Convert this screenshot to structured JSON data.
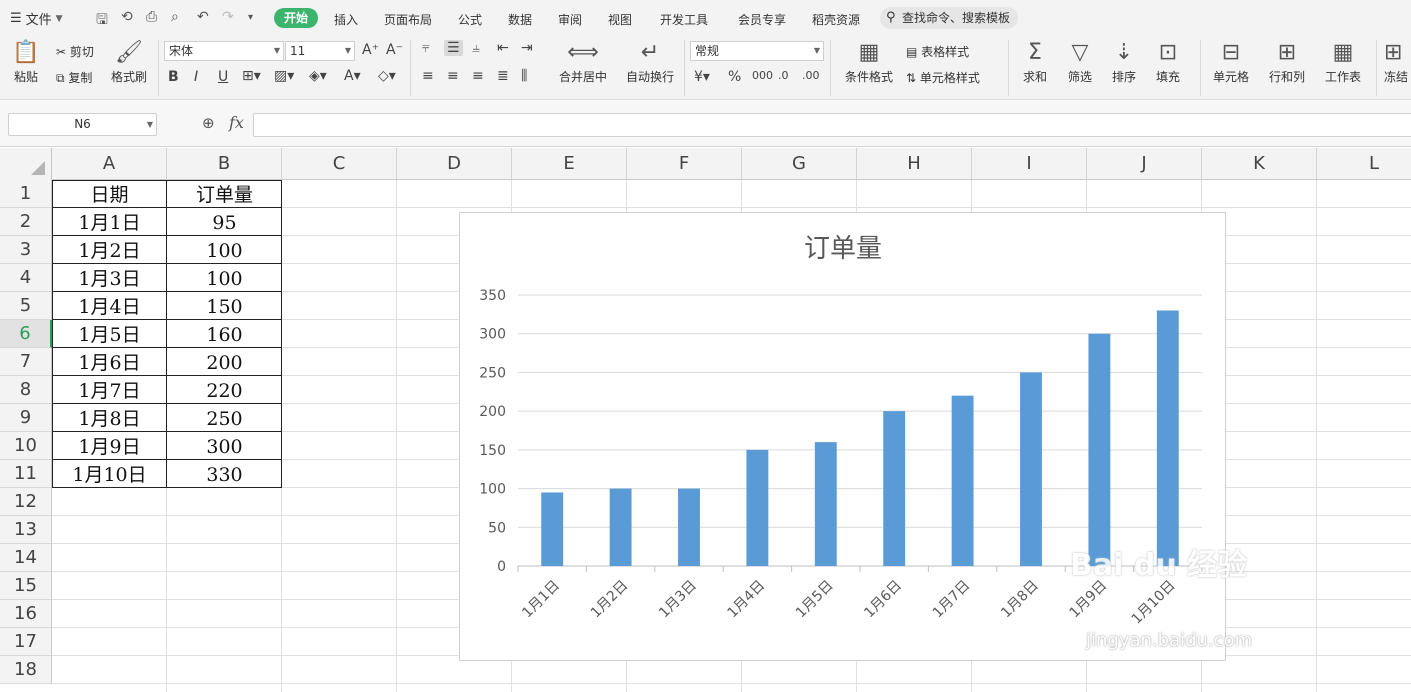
{
  "menu": {
    "file_label": "文件",
    "tabs": [
      "开始",
      "插入",
      "页面布局",
      "公式",
      "数据",
      "审阅",
      "视图",
      "开发工具",
      "会员专享",
      "稻壳资源"
    ],
    "search_label": "查找命令、搜索模板"
  },
  "ribbon": {
    "paste": "粘贴",
    "cut": "剪切",
    "copy": "复制",
    "format_painter": "格式刷",
    "font_name": "宋体",
    "font_size": "11",
    "merge_center": "合并居中",
    "wrap_text": "自动换行",
    "number_format": "常规",
    "cond_format": "条件格式",
    "table_style": "表格样式",
    "cell_style": "单元格样式",
    "sum": "求和",
    "filter": "筛选",
    "sort": "排序",
    "fill": "填充",
    "cell": "单元格",
    "row_col": "行和列",
    "worksheet": "工作表",
    "freeze": "冻结"
  },
  "formula_bar": {
    "name_box": "N6",
    "fx": "fx",
    "formula": ""
  },
  "grid": {
    "columns": [
      "A",
      "B",
      "C",
      "D",
      "E",
      "F",
      "G",
      "H",
      "I",
      "J",
      "K",
      "L"
    ],
    "rows": [
      "1",
      "2",
      "3",
      "4",
      "5",
      "6",
      "7",
      "8",
      "9",
      "10",
      "11",
      "12",
      "13",
      "14",
      "15",
      "16",
      "17",
      "18"
    ],
    "active_row": "6"
  },
  "table": {
    "header": [
      "日期",
      "订单量"
    ],
    "rows": [
      [
        "1月1日",
        "95"
      ],
      [
        "1月2日",
        "100"
      ],
      [
        "1月3日",
        "100"
      ],
      [
        "1月4日",
        "150"
      ],
      [
        "1月5日",
        "160"
      ],
      [
        "1月6日",
        "200"
      ],
      [
        "1月7日",
        "220"
      ],
      [
        "1月8日",
        "250"
      ],
      [
        "1月9日",
        "300"
      ],
      [
        "1月10日",
        "330"
      ]
    ]
  },
  "chart_data": {
    "type": "bar",
    "title": "订单量",
    "categories": [
      "1月1日",
      "1月2日",
      "1月3日",
      "1月4日",
      "1月5日",
      "1月6日",
      "1月7日",
      "1月8日",
      "1月9日",
      "1月10日"
    ],
    "values": [
      95,
      100,
      100,
      150,
      160,
      200,
      220,
      250,
      300,
      330
    ],
    "ylim": [
      0,
      350
    ],
    "yticks": [
      0,
      50,
      100,
      150,
      200,
      250,
      300,
      350
    ],
    "grid": true,
    "legend": "none",
    "bar_color": "#5b9bd5"
  },
  "watermark": {
    "main": "Bai du 经验",
    "sub": "jingyan.baidu.com"
  },
  "colors": {
    "accent": "#3cb46e",
    "active_row": "#2e9c57"
  }
}
